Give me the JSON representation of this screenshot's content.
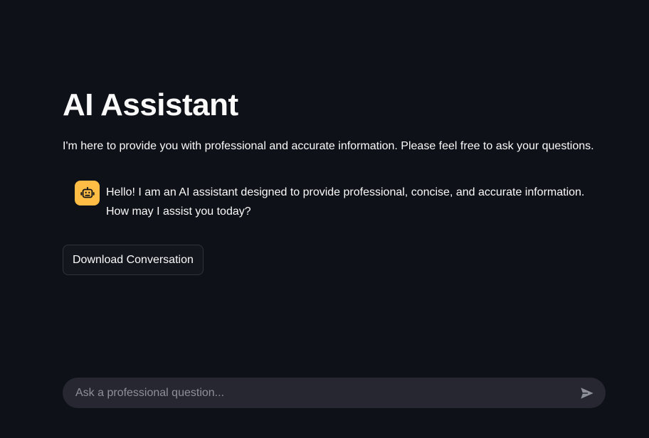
{
  "header": {
    "title": "AI Assistant",
    "subtitle": "I'm here to provide you with professional and accurate information. Please feel free to ask your questions."
  },
  "chat": {
    "messages": [
      {
        "role": "assistant",
        "avatar_icon": "robot-icon",
        "avatar_color": "#ffbd45",
        "text": "Hello! I am an AI assistant designed to provide professional, concise, and accurate information. How may I assist you today?"
      }
    ]
  },
  "actions": {
    "download_label": "Download Conversation"
  },
  "input": {
    "placeholder": "Ask a professional question...",
    "value": "",
    "send_icon": "send-icon"
  },
  "colors": {
    "background": "#0e1117",
    "text": "#fafafa",
    "input_background": "#262730",
    "accent": "#ffbd45"
  }
}
